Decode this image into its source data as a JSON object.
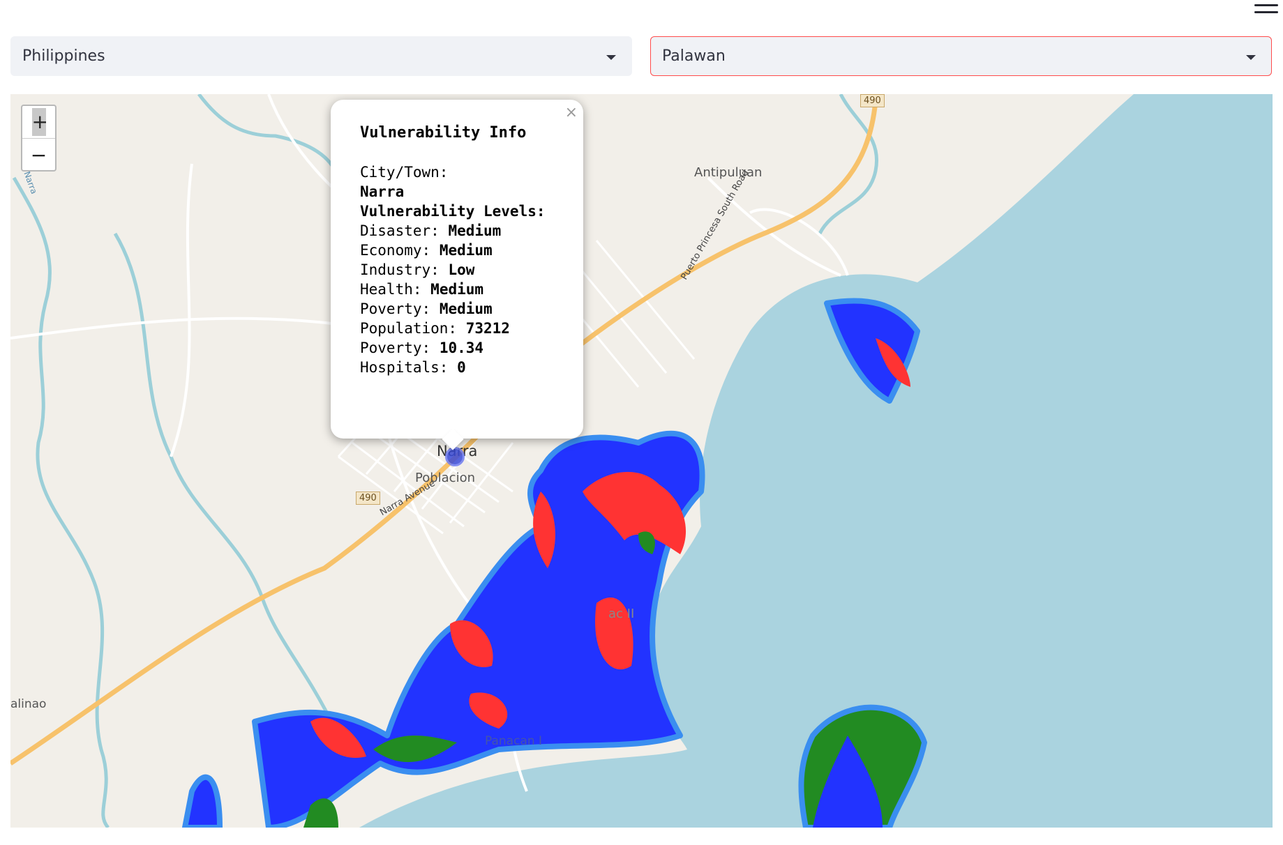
{
  "header": {
    "menu_icon": "hamburger-icon"
  },
  "selects": {
    "country": {
      "value": "Philippines"
    },
    "province": {
      "value": "Palawan",
      "accent": "#ff4b4b"
    }
  },
  "map": {
    "zoom_in": "+",
    "zoom_out": "−",
    "colors": {
      "high": "#ff3333",
      "medium": "#2233ff",
      "low": "#228b22",
      "outline": "#3a8ef0",
      "water": "#aad3df",
      "land": "#f2efe9",
      "road": "#f7c26b"
    },
    "labels": {
      "narra": "Narra",
      "poblacion": "Poblacion",
      "antipuluan": "Antipuluan",
      "narra_avenue": "Narra Avenue",
      "south_road": "Puerto Princesa South Road",
      "route_top": "490",
      "route_bottom": "490",
      "alinao": "alinao",
      "river_narra": "Narra",
      "panacan": "Panacan I",
      "panacan2": "ac II"
    }
  },
  "popup": {
    "close": "×",
    "title": "Vulnerability Info",
    "city_label": "City/Town:",
    "city": "Narra",
    "levels_label": "Vulnerability Levels:",
    "rows": [
      {
        "label": "Disaster:",
        "value": "Medium"
      },
      {
        "label": "Economy:",
        "value": "Medium"
      },
      {
        "label": "Industry:",
        "value": "Low"
      },
      {
        "label": "Health:",
        "value": "Medium"
      },
      {
        "label": "Poverty:",
        "value": "Medium"
      },
      {
        "label": "Population:",
        "value": "73212"
      },
      {
        "label": "Poverty:",
        "value": "10.34"
      },
      {
        "label": "Hospitals:",
        "value": "0"
      }
    ]
  }
}
